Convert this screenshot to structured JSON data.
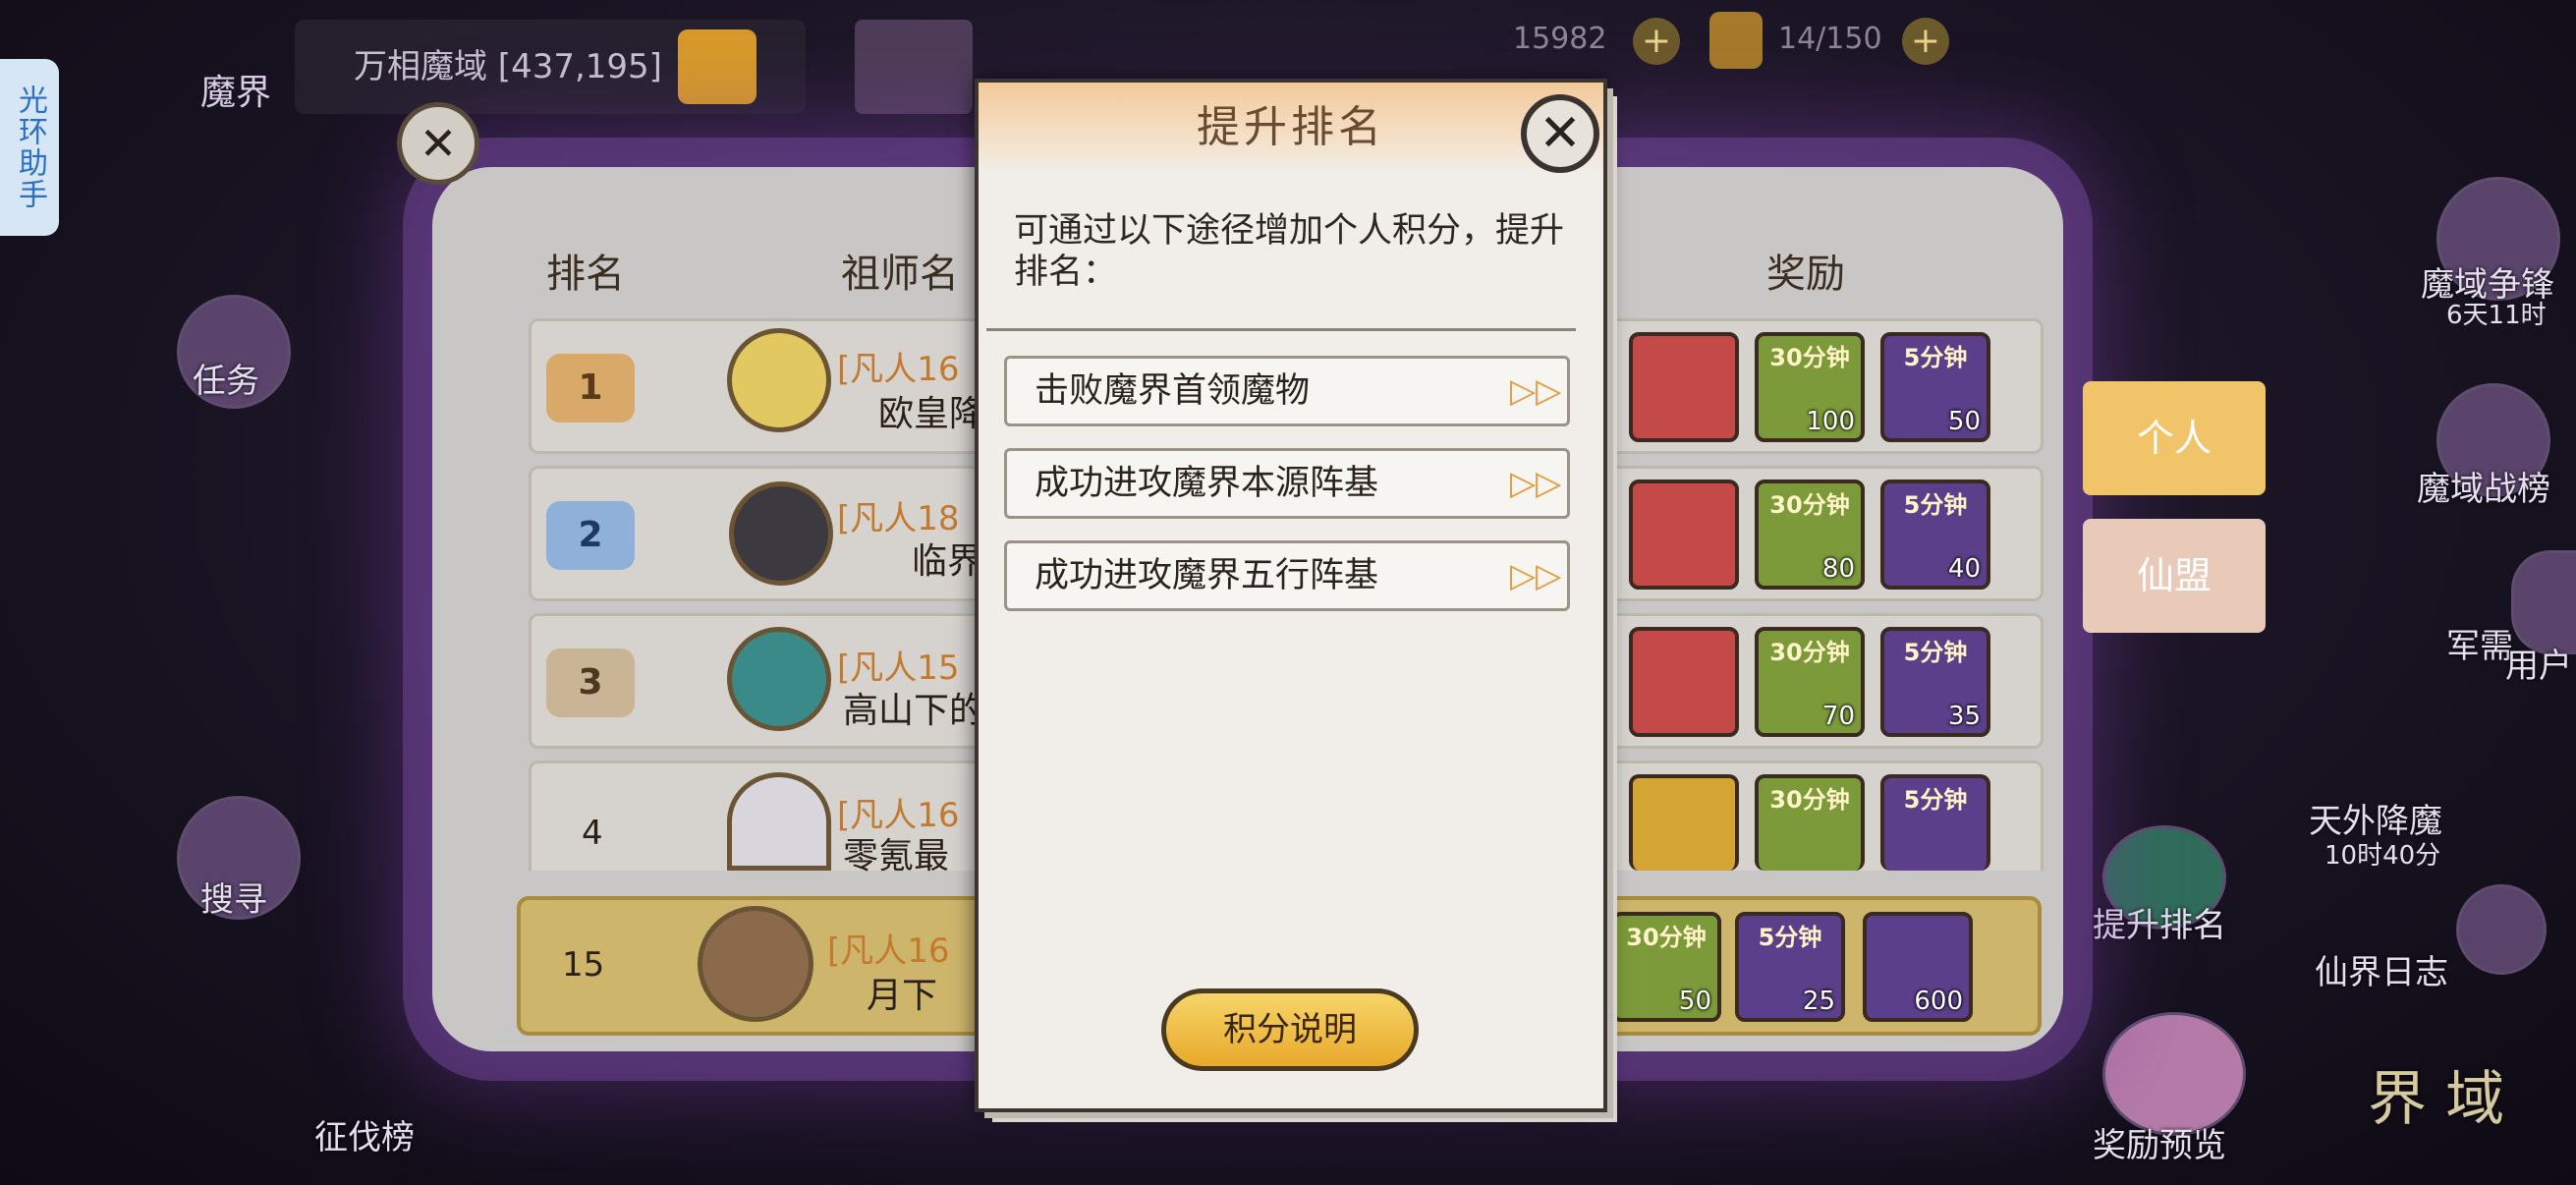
{
  "assistant": {
    "label": "光环助手"
  },
  "topbar": {
    "realm_tag": "魔界",
    "location": "万相魔域 [437,195]",
    "currency_value": "15982",
    "stamina": "14/150"
  },
  "ranking": {
    "headers": {
      "rank": "排名",
      "master": "祖师名",
      "reward": "奖励"
    },
    "rows": [
      {
        "rank": "1",
        "name_tag": "[凡人16",
        "name": "欧皇降",
        "rewards": [
          {
            "tag": "",
            "count": ""
          },
          {
            "tag": "30分钟",
            "count": "100"
          },
          {
            "tag": "5分钟",
            "count": "50"
          }
        ]
      },
      {
        "rank": "2",
        "name_tag": "[凡人18",
        "name": "临界",
        "rewards": [
          {
            "tag": "",
            "count": ""
          },
          {
            "tag": "30分钟",
            "count": "80"
          },
          {
            "tag": "5分钟",
            "count": "40"
          }
        ]
      },
      {
        "rank": "3",
        "name_tag": "[凡人15",
        "name": "高山下的",
        "rewards": [
          {
            "tag": "",
            "count": ""
          },
          {
            "tag": "30分钟",
            "count": "70"
          },
          {
            "tag": "5分钟",
            "count": "35"
          }
        ]
      },
      {
        "rank": "4",
        "name_tag": "[凡人16",
        "name": "零氪最",
        "rewards": [
          {
            "tag": "",
            "count": ""
          },
          {
            "tag": "30分钟",
            "count": ""
          },
          {
            "tag": "5分钟",
            "count": ""
          }
        ]
      }
    ],
    "mine": {
      "rank": "15",
      "name_tag": "[凡人16",
      "name": "月下",
      "rewards": [
        {
          "tag": "30分钟",
          "count": "50"
        },
        {
          "tag": "5分钟",
          "count": "25"
        },
        {
          "tag": "",
          "count": "600"
        }
      ]
    }
  },
  "tabs": {
    "personal": "个人",
    "alliance": "仙盟"
  },
  "side": {
    "left_task": "任务",
    "left_search": "搜寻",
    "left_bottom": "征伐榜",
    "right_1": "魔域争锋",
    "right_1_sub": "6天11时",
    "right_2": "魔域战榜",
    "right_3": "军需",
    "right_user": "用户",
    "right_4": "天外降魔",
    "right_4_sub": "10时40分",
    "right_5": "提升排名",
    "right_6": "仙界日志",
    "right_7": "奖励预览",
    "right_8": "界 域"
  },
  "dialog": {
    "title": "提升排名",
    "description": "可通过以下途径增加个人积分，提升排名：",
    "options": [
      {
        "label": "击败魔界首领魔物"
      },
      {
        "label": "成功进攻魔界本源阵基"
      },
      {
        "label": "成功进攻魔界五行阵基"
      }
    ],
    "score_button": "积分说明"
  }
}
